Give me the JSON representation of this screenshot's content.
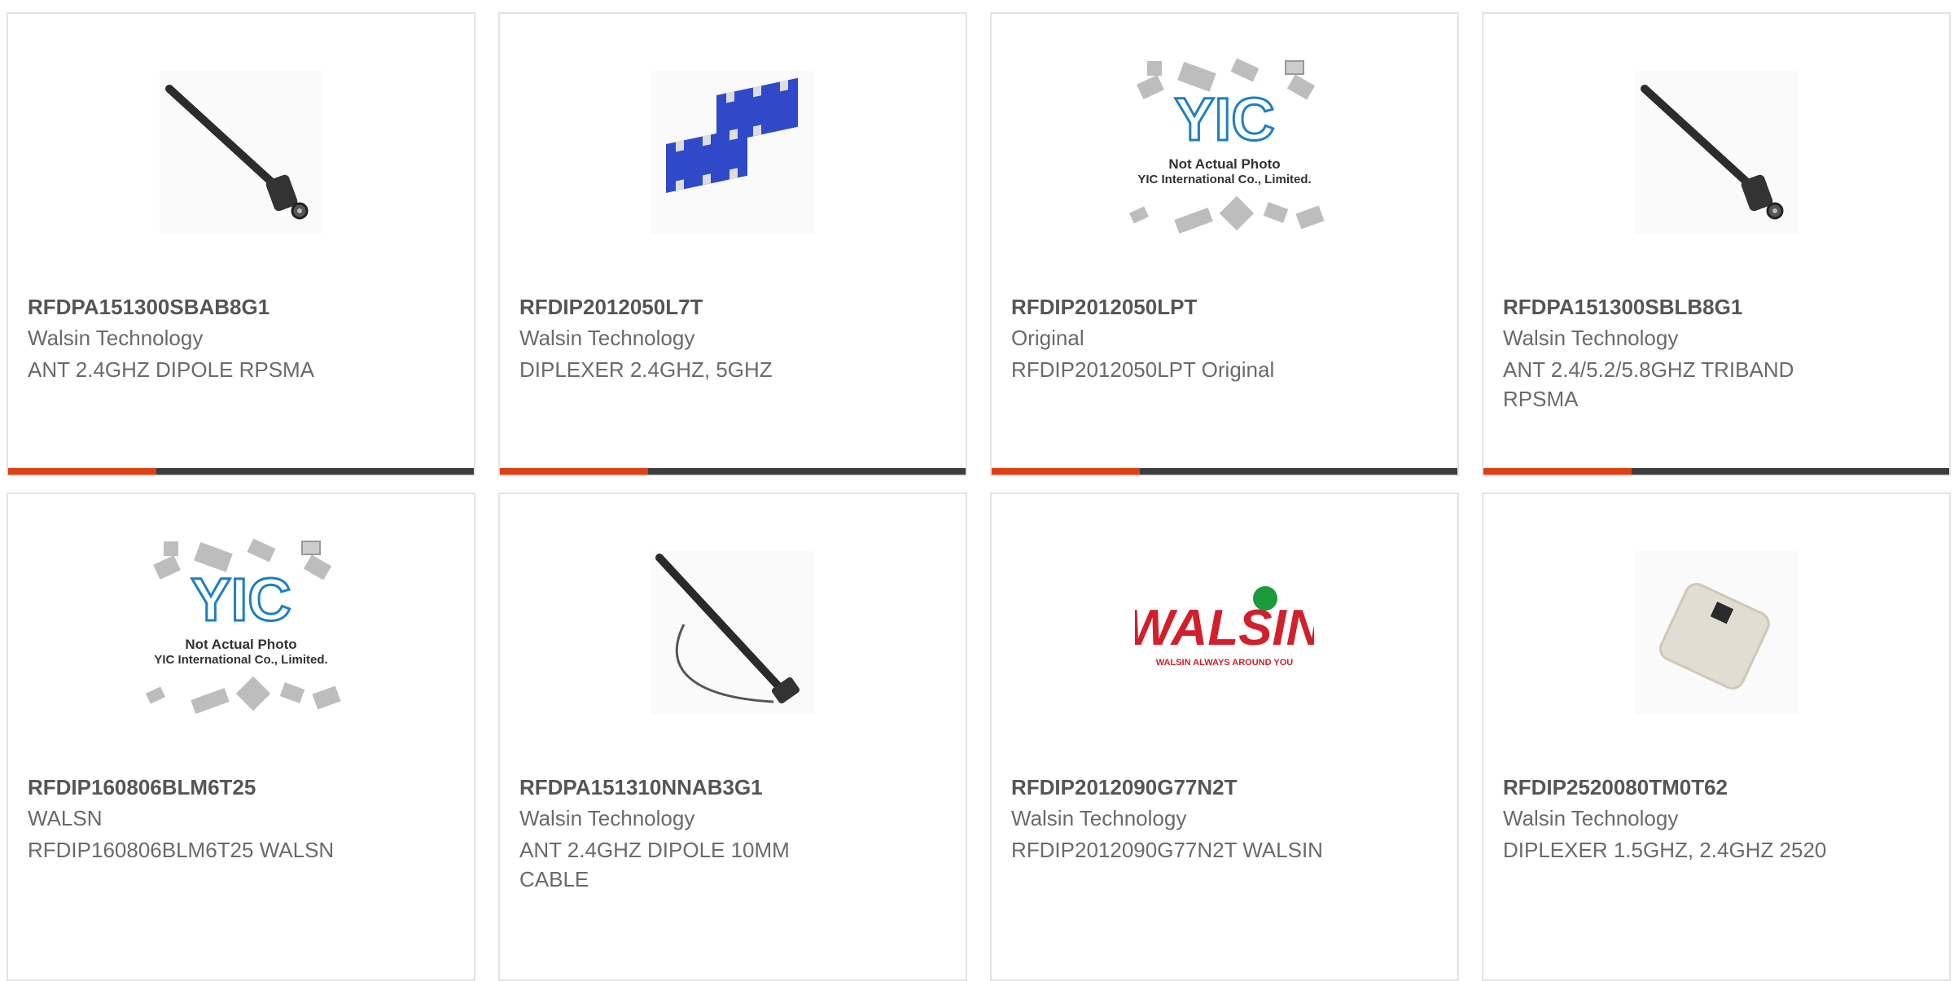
{
  "accent_color": "#e23c12",
  "bar_color": "#3d3d3d",
  "products": [
    {
      "part_number": "RFDPA151300SBAB8G1",
      "manufacturer": "Walsin Technology",
      "description": "ANT 2.4GHZ DIPOLE RPSMA",
      "image_icon": "antenna-image"
    },
    {
      "part_number": "RFDIP2012050L7T",
      "manufacturer": "Walsin Technology",
      "description": "DIPLEXER 2.4GHZ, 5GHZ",
      "image_icon": "diplexer-chip-image"
    },
    {
      "part_number": "RFDIP2012050LPT",
      "manufacturer": "Original",
      "description": "RFDIP2012050LPT Original",
      "image_icon": "placeholder-image",
      "image_text": {
        "logo": "YIC",
        "line1": "Not Actual Photo",
        "line2": "YIC International Co., Limited."
      }
    },
    {
      "part_number": "RFDPA151300SBLB8G1",
      "manufacturer": "Walsin Technology",
      "description": "ANT 2.4/5.2/5.8GHZ TRIBAND RPSMA",
      "image_icon": "antenna-image"
    },
    {
      "part_number": "RFDIP160806BLM6T25",
      "manufacturer": "WALSN",
      "description": "RFDIP160806BLM6T25 WALSN",
      "image_icon": "placeholder-image",
      "image_text": {
        "logo": "YIC",
        "line1": "Not Actual Photo",
        "line2": "YIC International Co., Limited."
      }
    },
    {
      "part_number": "RFDPA151310NNAB3G1",
      "manufacturer": "Walsin Technology",
      "description": "ANT 2.4GHZ DIPOLE 10MM CABLE",
      "image_icon": "antenna-cable-image"
    },
    {
      "part_number": "RFDIP2012090G77N2T",
      "manufacturer": "Walsin Technology",
      "description": "RFDIP2012090G77N2T WALSIN",
      "image_icon": "walsin-logo-image",
      "image_text": {
        "logo": "WALSIN",
        "tagline": "WALSIN ALWAYS AROUND YOU"
      }
    },
    {
      "part_number": "RFDIP2520080TM0T62",
      "manufacturer": "Walsin Technology",
      "description": "DIPLEXER 1.5GHZ, 2.4GHZ 2520",
      "image_icon": "ceramic-chip-image"
    }
  ]
}
